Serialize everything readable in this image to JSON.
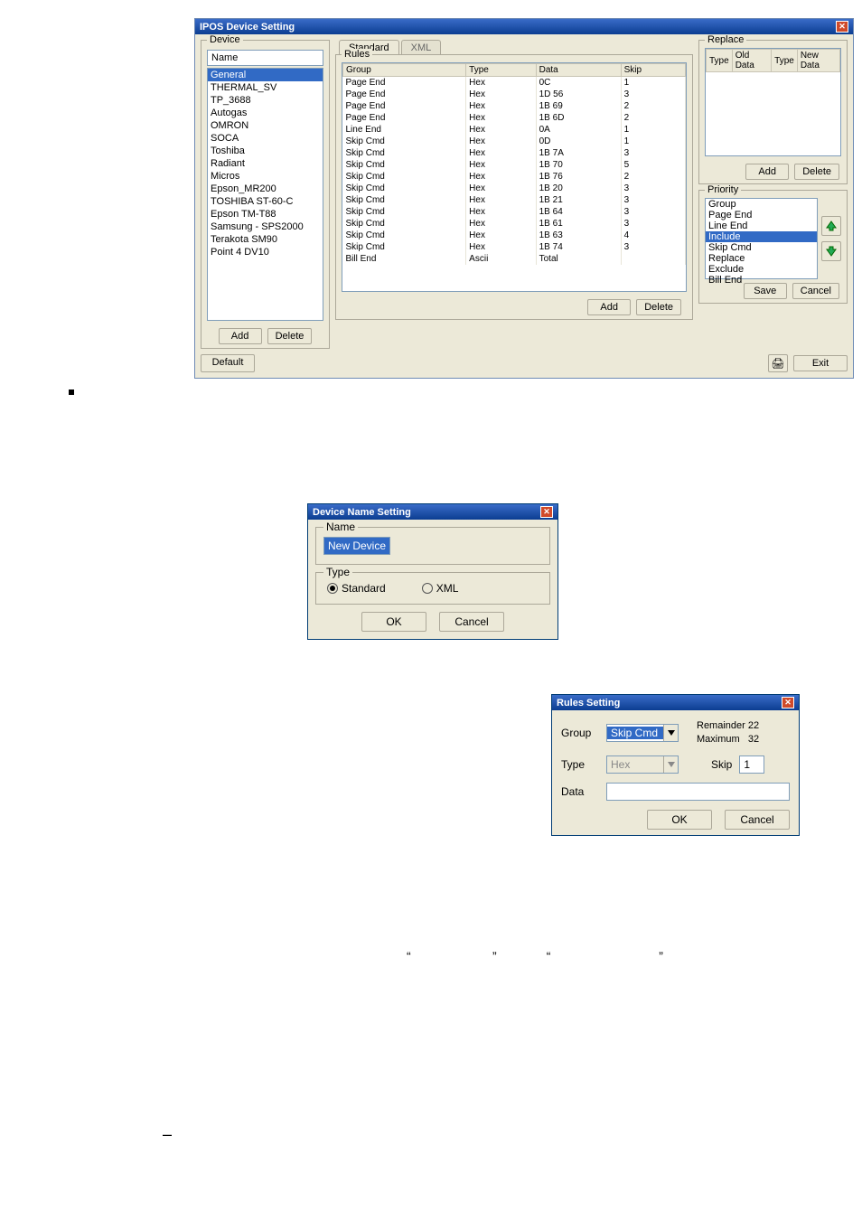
{
  "win1": {
    "title": "IPOS Device Setting",
    "device_legend": "Device",
    "device_name_label": "Name",
    "devices": [
      "General",
      "THERMAL_SV",
      "TP_3688",
      "Autogas",
      "OMRON",
      "SOCA",
      "Toshiba",
      "Radiant",
      "Micros",
      "Epson_MR200",
      "TOSHIBA ST-60-C",
      "Epson TM-T88",
      "Samsung - SPS2000",
      "Terakota SM90",
      "Point 4 DV10"
    ],
    "device_selected": 0,
    "device_add": "Add",
    "device_delete": "Delete",
    "tab_standard": "Standard",
    "tab_xml": "XML",
    "rules_legend": "Rules",
    "rules_headers": [
      "Group",
      "Type",
      "Data",
      "Skip"
    ],
    "rules_rows": [
      [
        "Page End",
        "Hex",
        "0C",
        "1"
      ],
      [
        "Page End",
        "Hex",
        "1D 56",
        "3"
      ],
      [
        "Page End",
        "Hex",
        "1B 69",
        "2"
      ],
      [
        "Page End",
        "Hex",
        "1B 6D",
        "2"
      ],
      [
        "Line End",
        "Hex",
        "0A",
        "1"
      ],
      [
        "Skip Cmd",
        "Hex",
        "0D",
        "1"
      ],
      [
        "Skip Cmd",
        "Hex",
        "1B 7A",
        "3"
      ],
      [
        "Skip Cmd",
        "Hex",
        "1B 70",
        "5"
      ],
      [
        "Skip Cmd",
        "Hex",
        "1B 76",
        "2"
      ],
      [
        "Skip Cmd",
        "Hex",
        "1B 20",
        "3"
      ],
      [
        "Skip Cmd",
        "Hex",
        "1B 21",
        "3"
      ],
      [
        "Skip Cmd",
        "Hex",
        "1B 64",
        "3"
      ],
      [
        "Skip Cmd",
        "Hex",
        "1B 61",
        "3"
      ],
      [
        "Skip Cmd",
        "Hex",
        "1B 63",
        "4"
      ],
      [
        "Skip Cmd",
        "Hex",
        "1B 74",
        "3"
      ],
      [
        "Bill End",
        "Ascii",
        "Total",
        ""
      ]
    ],
    "rules_add": "Add",
    "rules_delete": "Delete",
    "replace_legend": "Replace",
    "replace_headers": [
      "Type",
      "Old Data",
      "Type",
      "New Data"
    ],
    "replace_add": "Add",
    "replace_delete": "Delete",
    "priority_legend": "Priority",
    "priority_items": [
      "Group",
      "Page End",
      "Line End",
      "Include",
      "Skip Cmd",
      "Replace",
      "Exclude",
      "Bill End"
    ],
    "priority_selected": 3,
    "priority_save": "Save",
    "priority_cancel": "Cancel",
    "default_btn": "Default",
    "exit_btn": "Exit"
  },
  "win2": {
    "title": "Device Name Setting",
    "name_legend": "Name",
    "name_value": "New Device",
    "type_legend": "Type",
    "radio_standard": "Standard",
    "radio_xml": "XML",
    "ok": "OK",
    "cancel": "Cancel"
  },
  "win3": {
    "title": "Rules Setting",
    "group_label": "Group",
    "group_value": "Skip Cmd",
    "remainder_label": "Remainder",
    "remainder_value": "22",
    "maximum_label": "Maximum",
    "maximum_value": "32",
    "type_label": "Type",
    "type_value": "Hex",
    "skip_label": "Skip",
    "skip_value": "1",
    "data_label": "Data",
    "ok": "OK",
    "cancel": "Cancel"
  },
  "quotes": {
    "q1": "“",
    "q2": "”",
    "q3": "“",
    "q4": "”"
  },
  "dash": "–"
}
